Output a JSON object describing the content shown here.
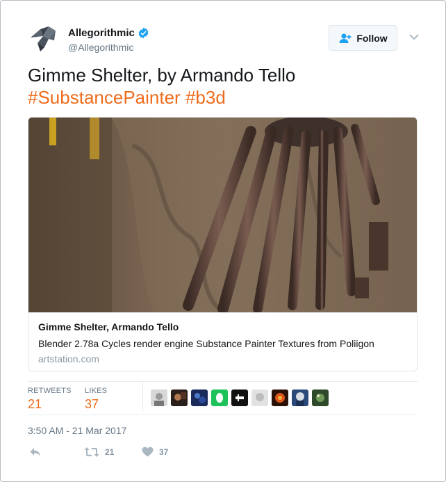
{
  "author": {
    "display_name": "Allegorithmic",
    "handle": "@Allegorithmic",
    "verified": true,
    "avatar_icon": "bird-logo-icon"
  },
  "follow_button": {
    "label": "Follow",
    "icon": "add-user-icon"
  },
  "more_menu": {
    "icon": "chevron-down-icon"
  },
  "tweet": {
    "text": "Gimme Shelter, by Armando Tello",
    "hashtags": [
      "#SubstancePainter",
      "#b3d"
    ]
  },
  "card": {
    "title": "Gimme Shelter, Armando Tello",
    "description": "Blender 2.78a Cycles render engine Substance Painter Textures from Poliigon",
    "domain": "artstation.com"
  },
  "stats": {
    "retweets_label": "RETWEETS",
    "retweets_value": "21",
    "likes_label": "LIKES",
    "likes_value": "37"
  },
  "liker_avatars": [
    "liker-1",
    "liker-2",
    "liker-3",
    "liker-4",
    "liker-5",
    "liker-6",
    "liker-7",
    "liker-8",
    "liker-9"
  ],
  "timestamp": "3:50 AM - 21 Mar 2017",
  "actions": {
    "reply_icon": "reply-icon",
    "retweet_icon": "retweet-icon",
    "retweet_count": "21",
    "like_icon": "heart-icon",
    "like_count": "37"
  },
  "colors": {
    "accent": "#ef6c1c",
    "verified": "#1da1f2",
    "muted": "#657786"
  }
}
